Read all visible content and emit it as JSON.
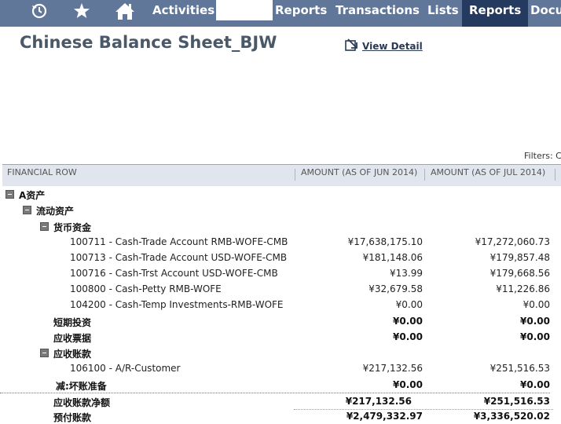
{
  "nav": {
    "icons": [
      "recent-icon",
      "star-icon",
      "home-icon"
    ],
    "items": [
      "Activities",
      "Reports",
      "Transactions",
      "Lists",
      "Reports",
      "Docu"
    ],
    "active_index": 4
  },
  "page": {
    "title": "Chinese Balance Sheet_BJW",
    "view_detail": "View Detail",
    "filters": "Filters: C"
  },
  "table": {
    "columns": [
      "FINANCIAL ROW",
      "AMOUNT (AS OF JUN 2014)",
      "AMOUNT (AS OF JUL 2014)"
    ],
    "rows": [
      {
        "label": "A资产",
        "v1": "",
        "v2": ""
      },
      {
        "label": "流动资产",
        "v1": "",
        "v2": ""
      },
      {
        "label": "货币资金",
        "v1": "",
        "v2": ""
      },
      {
        "label": "100711 - Cash-Trade Account RMB-WOFE-CMB",
        "v1": "¥17,638,175.10",
        "v2": "¥17,272,060.73"
      },
      {
        "label": "100713 - Cash-Trade Account USD-WOFE-CMB",
        "v1": "¥181,148.06",
        "v2": "¥179,857.48"
      },
      {
        "label": "100716 - Cash-Trst Account USD-WOFE-CMB",
        "v1": "¥13.99",
        "v2": "¥179,668.56"
      },
      {
        "label": "100800 - Cash-Petty RMB-WOFE",
        "v1": "¥32,679.58",
        "v2": "¥11,226.86"
      },
      {
        "label": "104200 - Cash-Temp Investments-RMB-WOFE",
        "v1": "¥0.00",
        "v2": "¥0.00"
      },
      {
        "label": "短期投资",
        "v1": "¥0.00",
        "v2": "¥0.00"
      },
      {
        "label": "应收票据",
        "v1": "¥0.00",
        "v2": "¥0.00"
      },
      {
        "label": "应收账款",
        "v1": "",
        "v2": ""
      },
      {
        "label": "106100 - A/R-Customer",
        "v1": "¥217,132.56",
        "v2": "¥251,516.53"
      },
      {
        "label": "减:坏账准备",
        "v1": "¥0.00",
        "v2": "¥0.00"
      },
      {
        "label": "应收账款净额",
        "v1": "¥217,132.56",
        "v2": "¥251,516.53"
      },
      {
        "label": "预付账款",
        "v1": "¥2,479,332.97",
        "v2": "¥3,336,520.02"
      }
    ]
  }
}
